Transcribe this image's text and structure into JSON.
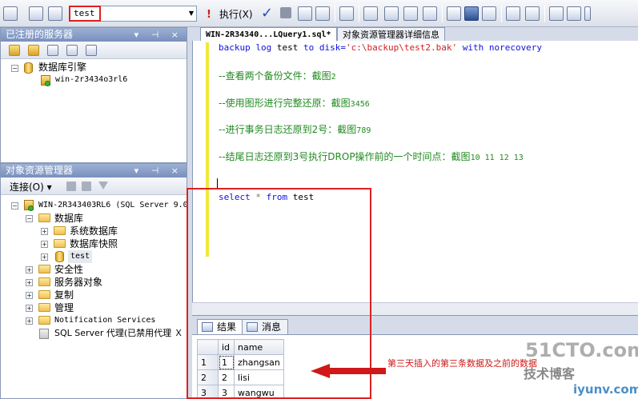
{
  "toolbar": {
    "database_selected": "test",
    "execute_label": "执行(X)"
  },
  "registered_servers": {
    "title": "已注册的服务器",
    "header_buttons": "▾ ⊣ ×",
    "tree": {
      "engine_label": "数据库引擎",
      "server_label": "win-2r3434o3rl6"
    }
  },
  "object_explorer": {
    "title": "对象资源管理器",
    "header_buttons": "▾ ⊣ ×",
    "connect_label": "连接(O) ▾",
    "server_node": "WIN-2R343403RL6 (SQL Server 9.0",
    "databases_label": "数据库",
    "system_databases_label": "系统数据库",
    "snapshots_label": "数据库快照",
    "test_db_label": "test",
    "security_label": "安全性",
    "server_objects_label": "服务器对象",
    "replication_label": "复制",
    "management_label": "管理",
    "notification_label": "Notification Services",
    "agent_label": "SQL Server 代理(已禁用代理 Ｘ"
  },
  "document_tabs": {
    "query_tab": "WIN-2R34340...LQuery1.sql*",
    "details_tab": "对象资源管理器详细信息"
  },
  "editor": {
    "line1": {
      "kw1": "backup",
      "kw2": "log",
      "ident": "test",
      "kw3": "to",
      "kw4": "disk=",
      "str": "'c:\\backup\\test2.bak'",
      "kw5": "with",
      "kw6": "norecovery"
    },
    "comments": [
      {
        "text": "--查看两个备份文件：截图",
        "num": "2"
      },
      {
        "text": "--使用图形进行完整还原：截图",
        "num": "3456"
      },
      {
        "text": "--进行事务日志还原到2号：截图",
        "num": "789"
      },
      {
        "text": "--结尾日志还原到3号执行DROP操作前的一个时间点：截图",
        "num": "10 11 12 13"
      }
    ],
    "select_line": {
      "kw1": "select",
      "star": "*",
      "kw2": "from",
      "ident": "test"
    }
  },
  "results": {
    "tab_results": "结果",
    "tab_messages": "消息",
    "columns": [
      "id",
      "name"
    ],
    "rows": [
      {
        "rownum": "1",
        "id": "1",
        "name": "zhangsan"
      },
      {
        "rownum": "2",
        "id": "2",
        "name": "lisi"
      },
      {
        "rownum": "3",
        "id": "3",
        "name": "wangwu"
      }
    ]
  },
  "annotation": {
    "text": "第三天插入的第三条数据及之前的数据",
    "color": "#d01818"
  },
  "watermark": {
    "site": "51CTO.com",
    "tagline": "技术博客",
    "site2": "iyunv.com"
  },
  "colors": {
    "keyword": "#1010e0",
    "string": "#d02020",
    "comment": "#218a21",
    "highlight": "#e02020"
  }
}
